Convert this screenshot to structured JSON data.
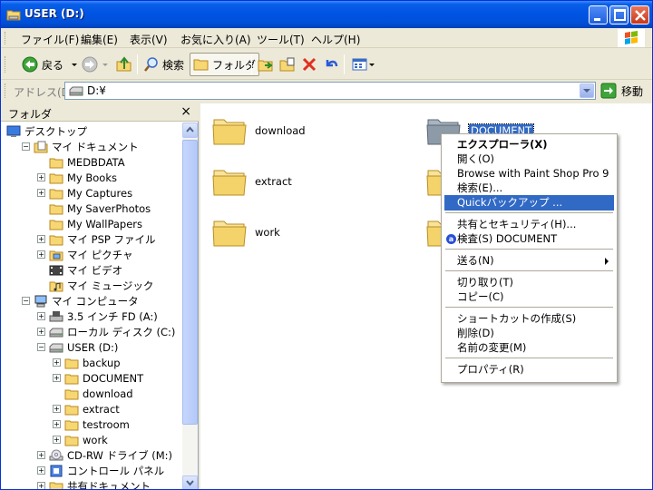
{
  "window": {
    "title": "USER (D:)"
  },
  "menubar": {
    "items": [
      "ファイル(F)",
      "編集(E)",
      "表示(V)",
      "お気に入り(A)",
      "ツール(T)",
      "ヘルプ(H)"
    ]
  },
  "toolbar": {
    "back_label": "戻る",
    "search_label": "検索",
    "folders_label": "フォルダ"
  },
  "address": {
    "label": "アドレス(D)",
    "value": "D:¥",
    "go_label": "移動"
  },
  "folderpane": {
    "title": "フォルダ",
    "close_glyph": "×",
    "tree": [
      {
        "label": "デスクトップ",
        "indent": 0,
        "expander": "",
        "icon": "desktop-icon"
      },
      {
        "label": "マイ ドキュメント",
        "indent": 1,
        "expander": "−",
        "icon": "my-documents-icon"
      },
      {
        "label": "MEDBDATA",
        "indent": 2,
        "expander": "",
        "icon": "folder-icon"
      },
      {
        "label": "My Books",
        "indent": 2,
        "expander": "+",
        "icon": "folder-icon"
      },
      {
        "label": "My Captures",
        "indent": 2,
        "expander": "+",
        "icon": "folder-icon"
      },
      {
        "label": "My SaverPhotos",
        "indent": 2,
        "expander": "",
        "icon": "folder-icon"
      },
      {
        "label": "My WallPapers",
        "indent": 2,
        "expander": "",
        "icon": "folder-icon"
      },
      {
        "label": "マイ PSP ファイル",
        "indent": 2,
        "expander": "+",
        "icon": "folder-icon"
      },
      {
        "label": "マイ ピクチャ",
        "indent": 2,
        "expander": "+",
        "icon": "pictures-icon"
      },
      {
        "label": "マイ ビデオ",
        "indent": 2,
        "expander": "",
        "icon": "video-icon"
      },
      {
        "label": "マイ ミュージック",
        "indent": 2,
        "expander": "",
        "icon": "music-icon"
      },
      {
        "label": "マイ コンピュータ",
        "indent": 1,
        "expander": "−",
        "icon": "my-computer-icon"
      },
      {
        "label": "3.5 インチ FD (A:)",
        "indent": 2,
        "expander": "+",
        "icon": "floppy-icon"
      },
      {
        "label": "ローカル ディスク (C:)",
        "indent": 2,
        "expander": "+",
        "icon": "hard-drive-icon"
      },
      {
        "label": "USER (D:)",
        "indent": 2,
        "expander": "−",
        "icon": "hard-drive-icon"
      },
      {
        "label": "backup",
        "indent": 3,
        "expander": "+",
        "icon": "folder-icon"
      },
      {
        "label": "DOCUMENT",
        "indent": 3,
        "expander": "+",
        "icon": "folder-icon"
      },
      {
        "label": "download",
        "indent": 3,
        "expander": "",
        "icon": "folder-icon"
      },
      {
        "label": "extract",
        "indent": 3,
        "expander": "+",
        "icon": "folder-icon"
      },
      {
        "label": "testroom",
        "indent": 3,
        "expander": "+",
        "icon": "folder-icon"
      },
      {
        "label": "work",
        "indent": 3,
        "expander": "+",
        "icon": "folder-icon"
      },
      {
        "label": "CD-RW ドライブ (M:)",
        "indent": 2,
        "expander": "+",
        "icon": "cd-drive-icon"
      },
      {
        "label": "コントロール パネル",
        "indent": 2,
        "expander": "+",
        "icon": "control-panel-icon"
      },
      {
        "label": "共有ドキュメント",
        "indent": 2,
        "expander": "+",
        "icon": "folder-icon"
      }
    ]
  },
  "content": {
    "folders": [
      {
        "label": "download",
        "selected": false
      },
      {
        "label": "DOCUMENT",
        "selected": true
      },
      {
        "label": "extract",
        "selected": false
      },
      {
        "label": "",
        "selected": false
      },
      {
        "label": "work",
        "selected": false
      },
      {
        "label": "",
        "selected": false
      }
    ]
  },
  "context_menu": {
    "items": [
      {
        "label": "エクスプローラ(X)",
        "bold": true
      },
      {
        "label": "開く(O)"
      },
      {
        "label": "Browse with Paint Shop Pro 9"
      },
      {
        "label": "検索(E)..."
      },
      {
        "label": "Quickバックアップ ...",
        "highlighted": true
      },
      {
        "separator": true
      },
      {
        "label": "共有とセキュリティ(H)..."
      },
      {
        "label": "検査(S) DOCUMENT",
        "icon": "antivirus-icon"
      },
      {
        "separator": true
      },
      {
        "label": "送る(N)",
        "submenu": true
      },
      {
        "separator": true
      },
      {
        "label": "切り取り(T)"
      },
      {
        "label": "コピー(C)"
      },
      {
        "separator": true
      },
      {
        "label": "ショートカットの作成(S)"
      },
      {
        "label": "削除(D)"
      },
      {
        "label": "名前の変更(M)"
      },
      {
        "separator": true
      },
      {
        "label": "プロパティ(R)"
      }
    ]
  }
}
